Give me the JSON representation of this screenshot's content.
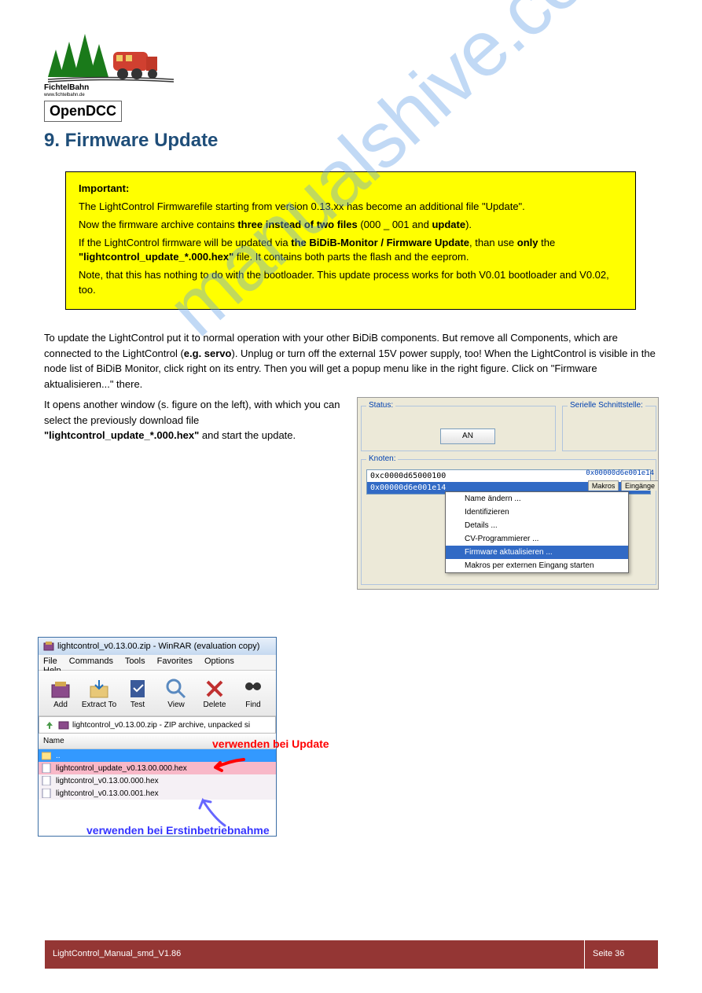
{
  "logo": {
    "name": "FichtelBahn",
    "url": "www.fichtelbahn.de",
    "sub": "OpenDCC"
  },
  "section_title": "9. Firmware Update",
  "yellow_box": {
    "label": "Important:",
    "line1": "The LightControl Firmwarefile starting from version 0.13.xx has become an additional file \"Update\".",
    "line2_pre": "Now the firmware archive contains ",
    "line2_bold1": "three instead of two files",
    "line2_mid": " (000 _ 001 and ",
    "line2_bold2": "update",
    "line2_end": ").",
    "line3_pre": "If the LightControl firmware will be updated via ",
    "line3_bold1": "the BiDiB-Monitor / Firmware Update",
    "line3_mid": ", than use ",
    "line3_bold2": "only",
    "line3_post": " the",
    "line3_file": "\"lightcontrol_update_*.000.hex\"",
    "line3_tail": " file. It contains both parts the flash and the eeprom.",
    "line4": "Note, that this has nothing to do with the bootloader. This update process works for both V0.01 bootloader and V0.02, too."
  },
  "text1": {
    "part1": "To update the LightControl put it to normal operation with your other BiDiB components. But remove all Components, which are connected to the LightControl (",
    "bold1": "e.g. servo",
    "part2": "). Unplug or turn off the external 15V power supply, too! When the LightControl is visible in the node list of BiDiB Monitor, click right on its entry. Then you will get a popup menu like in the right figure. Click on \"Firmware aktualisieren...\" there."
  },
  "text2": {
    "part1": "It opens another window (s. figure on the left), with which you can select the previously download file ",
    "bold1": "\"lightcontrol_update_*.000.hex\"",
    "part2": " and start the update."
  },
  "monitor": {
    "status_label": "Status:",
    "an_button": "AN",
    "serial_label": "Serielle Schnittstelle:",
    "knoten_label": "Knoten:",
    "node1": "0xc0000d65000100",
    "node2": "0x00000d6e001e14",
    "node_right": "0x00000d6e001e14",
    "tab1": "Makros",
    "tab2": "Eingänge",
    "menu": {
      "item1": "Name ändern ...",
      "item2": "Identifizieren",
      "item3": "Details ...",
      "item4": "CV-Programmierer ...",
      "item5": "Firmware aktualisieren ...",
      "item6": "Makros per externen Eingang starten"
    }
  },
  "winrar": {
    "title": "lightcontrol_v0.13.00.zip - WinRAR (evaluation copy)",
    "menu": {
      "file": "File",
      "commands": "Commands",
      "tools": "Tools",
      "favorites": "Favorites",
      "options": "Options",
      "help": "Help"
    },
    "toolbar": {
      "add": "Add",
      "extract": "Extract To",
      "test": "Test",
      "view": "View",
      "delete": "Delete",
      "find": "Find"
    },
    "path": "lightcontrol_v0.13.00.zip - ZIP archive, unpacked si",
    "name_header": "Name",
    "files": {
      "folder": "..",
      "f1": "lightcontrol_update_v0.13.00.000.hex",
      "f2": "lightcontrol_v0.13.00.000.hex",
      "f3": "lightcontrol_v0.13.00.001.hex"
    }
  },
  "annotation_red": "verwenden bei Update",
  "annotation_purple": "verwenden bei Erstinbetriebnahme",
  "watermark": "manualshive.com",
  "footer": {
    "left": "LightControl_Manual_smd_V1.86",
    "right": "Seite 36"
  }
}
